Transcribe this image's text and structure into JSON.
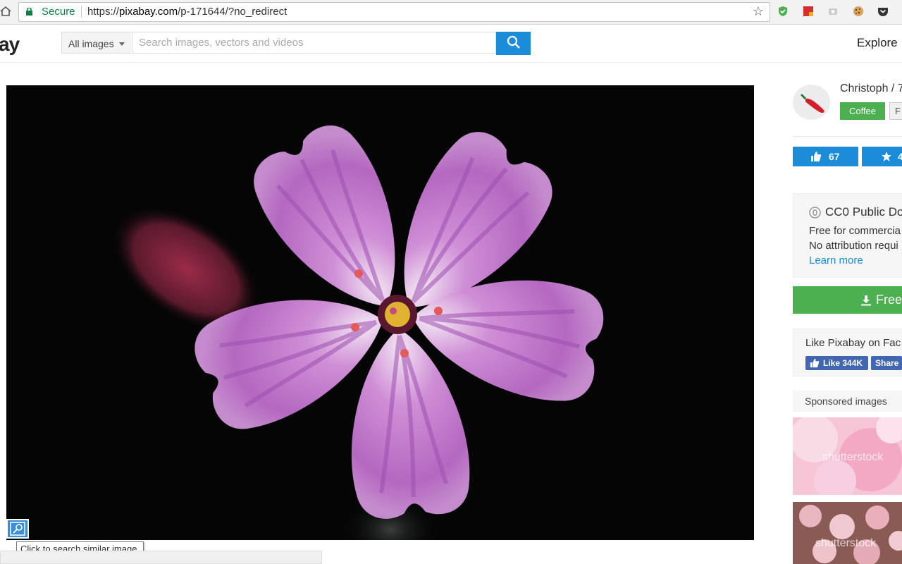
{
  "browser": {
    "secure_label": "Secure",
    "url_scheme": "https://",
    "url_host": "pixabay.com",
    "url_path": "/p-171644/?no_redirect",
    "icons": [
      "home-icon",
      "lock-icon",
      "bookmark-star-icon",
      "shield-extension-icon",
      "red-extension-icon",
      "gray-extension-icon",
      "cookie-extension-icon",
      "pocket-extension-icon"
    ]
  },
  "header": {
    "logo_text": "ay",
    "filter_label": "All images",
    "search_placeholder": "Search images, vectors and videos",
    "explore_label": "Explore"
  },
  "photo": {
    "similar_tooltip": "Click to search similar image."
  },
  "sidebar": {
    "user_name": "Christoph / 7",
    "coffee_label": "Coffee",
    "follow_label": "F",
    "likes_count": "67",
    "favorites_count": "4",
    "license": {
      "title": "CC0 Public Do",
      "line1": "Free for commercia",
      "line2": "No attribution requi",
      "learn_more": "Learn more"
    },
    "download_label": "Free",
    "facebook": {
      "prompt": "Like Pixabay on Fac",
      "like_label": "Like 344K",
      "share_label": "Share"
    },
    "sponsored_label": "Sponsored images",
    "watermark": "shutterstock"
  },
  "colors": {
    "accent_blue": "#1a8cd8",
    "green": "#4caf50",
    "facebook_blue": "#4267b2",
    "secure_green": "#0b8043"
  }
}
